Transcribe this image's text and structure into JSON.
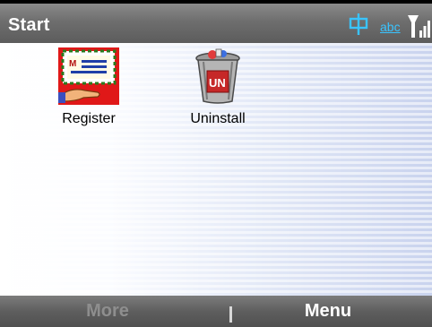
{
  "header": {
    "title": "Start",
    "ime_icon": "chinese-input-icon",
    "input_mode": "abc",
    "signal_icon": "signal-strength-icon"
  },
  "apps": [
    {
      "label": "Register",
      "icon": "register-icon"
    },
    {
      "label": "Uninstall",
      "icon": "uninstall-icon"
    }
  ],
  "softkeys": {
    "left": "More",
    "right": "Menu"
  },
  "colors": {
    "accent": "#39c4ff",
    "register_bg": "#e01818",
    "softkey_disabled": "#8e8e8e"
  }
}
